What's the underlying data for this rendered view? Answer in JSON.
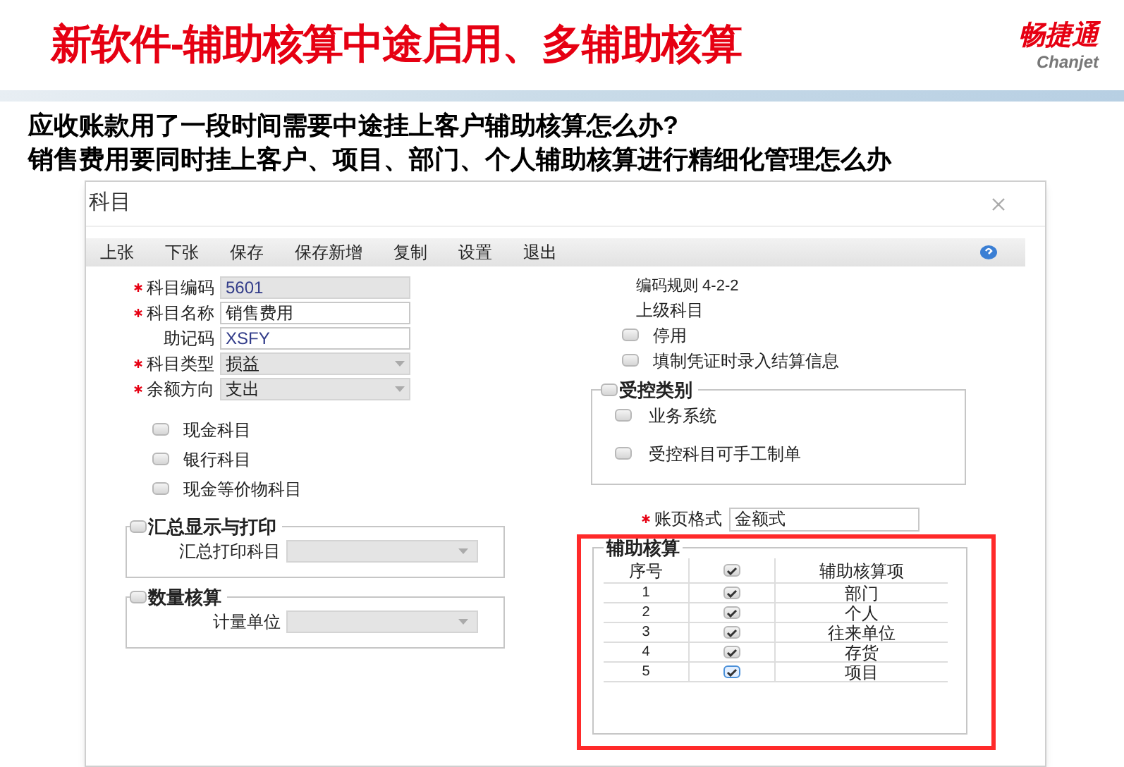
{
  "slide": {
    "title": "新软件-辅助核算中途启用、多辅助核算",
    "logo": {
      "name": "畅捷通",
      "latin": "Chanjet"
    },
    "questions": [
      "应收账款用了一段时间需要中途挂上客户辅助核算怎么办?",
      "销售费用要同时挂上客户、项目、部门、个人辅助核算进行精细化管理怎么办"
    ]
  },
  "dialog": {
    "title": "科目",
    "toolbar": [
      "上张",
      "下张",
      "保存",
      "保存新增",
      "复制",
      "设置",
      "退出"
    ],
    "fields": [
      {
        "label": "科目编码",
        "required": true,
        "kind": "text",
        "disabled": true,
        "value": "5601"
      },
      {
        "label": "科目名称",
        "required": true,
        "kind": "text",
        "disabled": false,
        "value": "销售费用"
      },
      {
        "label": "助记码",
        "required": false,
        "kind": "text",
        "disabled": false,
        "value": "XSFY"
      },
      {
        "label": "科目类型",
        "required": true,
        "kind": "select",
        "disabled": true,
        "value": "损益"
      },
      {
        "label": "余额方向",
        "required": true,
        "kind": "select",
        "disabled": true,
        "value": "支出"
      }
    ],
    "account_flags": [
      {
        "label": "现金科目",
        "checked": false
      },
      {
        "label": "银行科目",
        "checked": false
      },
      {
        "label": "现金等价物科目",
        "checked": false
      }
    ],
    "summary_group": {
      "title": "汇总显示与打印",
      "checked": false,
      "field_label": "汇总打印科目"
    },
    "quantity_group": {
      "title": "数量核算",
      "checked": false,
      "field_label": "计量单位"
    },
    "code_rule": "编码规则 4-2-2",
    "parent_label": "上级科目",
    "options": [
      {
        "label": "停用",
        "checked": false
      },
      {
        "label": "填制凭证时录入结算信息",
        "checked": false
      }
    ],
    "control_group": {
      "title": "受控类别",
      "checked": false,
      "items": [
        {
          "label": "业务系统",
          "checked": false
        },
        {
          "label": "受控科目可手工制单",
          "checked": false
        }
      ]
    },
    "ledger_format": {
      "label": "账页格式",
      "required": true,
      "value": "金额式"
    },
    "auxiliary": {
      "title": "辅助核算",
      "highlighted": true,
      "columns": [
        "序号",
        "辅助核算项"
      ],
      "header_checked": true,
      "rows": [
        {
          "no": "1",
          "checked": true,
          "focused": false,
          "item": "部门"
        },
        {
          "no": "2",
          "checked": true,
          "focused": false,
          "item": "个人"
        },
        {
          "no": "3",
          "checked": true,
          "focused": false,
          "item": "往来单位"
        },
        {
          "no": "4",
          "checked": true,
          "focused": false,
          "item": "存货"
        },
        {
          "no": "5",
          "checked": true,
          "focused": true,
          "item": "项目"
        }
      ]
    }
  }
}
